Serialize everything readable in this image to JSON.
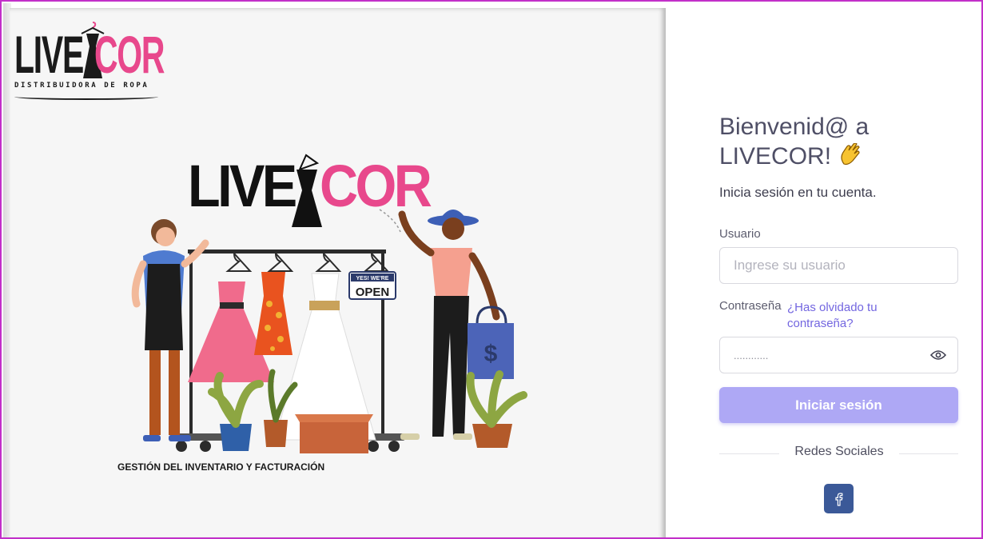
{
  "brand": {
    "logo_small": {
      "live": "LIVE",
      "cor": "COR",
      "tagline": "DISTRIBUIDORA DE ROPA"
    },
    "logo_big": {
      "live": "LIVE",
      "cor": "COR"
    },
    "illustration_caption": "GESTIÓN DEL INVENTARIO Y FACTURACIÓN",
    "open_sign": {
      "top": "YES! WE'RE",
      "bottom": "OPEN"
    },
    "bag_symbol": "$",
    "colors": {
      "pink": "#e8488c",
      "dark": "#111111"
    }
  },
  "login": {
    "welcome": "Bienvenid@ a LIVECOR!",
    "wave_icon": "waving-hand-icon",
    "subtitle": "Inicia sesión en tu cuenta.",
    "username_label": "Usuario",
    "username_placeholder": "Ingrese su usuario",
    "password_label": "Contraseña",
    "forgot_password": "¿Has olvidado tu contraseña?",
    "password_value": "............",
    "show_password_icon": "eye-icon",
    "submit_label": "Iniciar sesión",
    "social_divider": "Redes Sociales",
    "facebook_icon": "facebook-icon",
    "colors": {
      "primary": "#7366e0",
      "button": "#aea8f5",
      "facebook": "#3b5998"
    }
  }
}
